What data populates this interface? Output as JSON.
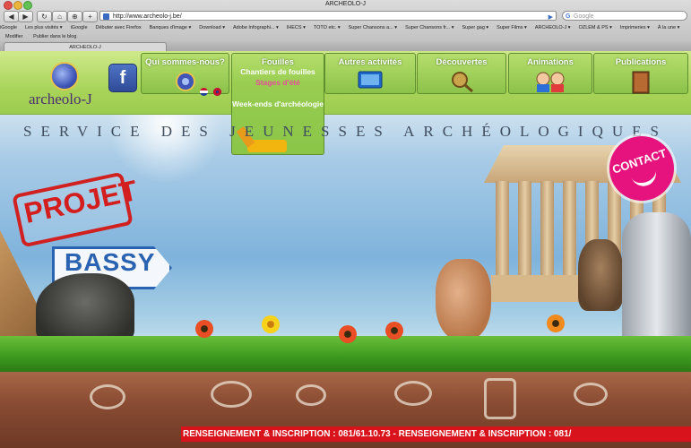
{
  "browser": {
    "window_title": "ARCHEOLO-J",
    "url": "http://www.archeolo-j.be/",
    "search_placeholder": "Google",
    "search_logo": "G",
    "bookmarks": [
      "iGoogle",
      "Les plus visités ▾",
      "iGoogle",
      "Débuter avec Firefox",
      "Banques d'image ▾",
      "Download ▾",
      "Adobe Infographi... ▾",
      "IHECS ▾",
      "TOTO etc. ▾",
      "Super Chansons a... ▾",
      "Super Chansons fr... ▾",
      "Super gag ▾",
      "Super Films ▾",
      "ARCHEOLO-J ▾",
      "OZLEM & PS ▾",
      "Imprimeries ▾",
      "À la une ▾"
    ],
    "toolbar_items": [
      "Modifier",
      "Publier dans le blog"
    ],
    "tab_title": "ARCHEOLO-J",
    "nav": {
      "back": "◀",
      "forward": "▶",
      "reload": "↻",
      "home": "⌂",
      "rss": "⊕",
      "add": "+",
      "go": "▶"
    }
  },
  "site": {
    "logo_text": "archeolo-J",
    "facebook_label": "f",
    "menu": [
      {
        "label": "Qui sommes-nous?",
        "icon": "globe-logo-icon"
      },
      {
        "label": "Fouilles",
        "icon": "excavator-icon",
        "sub": [
          "Chantiers de fouilles",
          "Stages d'été",
          "Week-ends d'archéologie"
        ]
      },
      {
        "label": "Autres activités",
        "icon": "monitor-icon"
      },
      {
        "label": "Découvertes",
        "icon": "magnifier-icon"
      },
      {
        "label": "Animations",
        "icon": "characters-icon"
      },
      {
        "label": "Publications",
        "icon": "book-icon"
      }
    ],
    "service_banner": "SERVICE DES JEUNESSES ARCHÉOLOGIQUES",
    "projet_stamp": "PROJET",
    "sign_text": "BASSY",
    "contact_label": "CONTACT",
    "ticker": "RENSEIGNEMENT & INSCRIPTION : 081/61.10.73 - RENSEIGNEMENT & INSCRIPTION : 081/",
    "colors": {
      "header_green": "#9ccc4f",
      "pink": "#e6127d",
      "red": "#d9131b",
      "blue_sign": "#2a63b1"
    }
  }
}
